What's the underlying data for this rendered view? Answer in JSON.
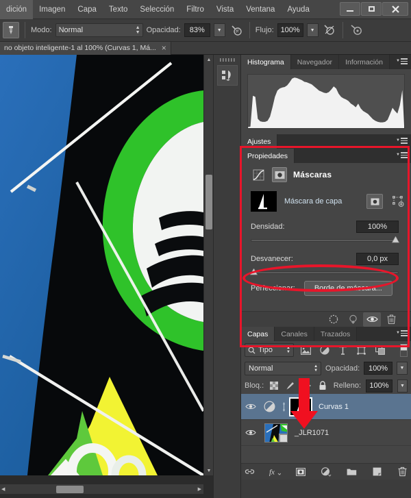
{
  "window": {
    "controls": [
      {
        "name": "minimize",
        "glyph": "—"
      },
      {
        "name": "maximize",
        "glyph": "❐"
      },
      {
        "name": "close",
        "glyph": "✕"
      }
    ]
  },
  "menubar": {
    "items": [
      "dición",
      "Imagen",
      "Capa",
      "Texto",
      "Selección",
      "Filtro",
      "Vista",
      "Ventana",
      "Ayuda"
    ]
  },
  "options_bar": {
    "tool_icon": "brush-tool-icon",
    "mode_label": "Modo:",
    "mode_value": "Normal",
    "opacity_label": "Opacidad:",
    "opacity_value": "83%",
    "airbrush_icon": "airbrush-icon",
    "flow_label": "Flujo:",
    "flow_value": "100%",
    "tablet_pressure_icon": "tablet-pressure-icon",
    "airbrush2_icon": "airbrush-alt-icon"
  },
  "document_tab": {
    "title": "no objeto inteligente-1 al 100% (Curvas 1, Má...",
    "close_glyph": "×"
  },
  "side_dock": {
    "button_name": "history-actions-icon"
  },
  "histogram_panel": {
    "tabs": [
      {
        "label": "Histograma",
        "active": true
      },
      {
        "label": "Navegador",
        "active": false
      },
      {
        "label": "Información",
        "active": false
      }
    ]
  },
  "adjustments_panel": {
    "tabs": [
      {
        "label": "Ajustes",
        "active": true
      }
    ]
  },
  "properties_panel": {
    "tabs": [
      {
        "label": "Propiedades",
        "active": true
      }
    ],
    "header": {
      "curves_icon": "curves-adjustment-icon",
      "pixel_mask_icon": "pixel-mask-icon",
      "title": "Máscaras"
    },
    "mask_row": {
      "thumb_name": "layer-mask-thumbnail",
      "label": "Máscara de capa",
      "pixel_mask_button": "pixel-mask-button",
      "vector_mask_button": "vector-mask-button"
    },
    "density": {
      "label": "Densidad:",
      "value": "100%",
      "knob_percent": 100
    },
    "feather": {
      "label": "Desvanecer:",
      "value": "0,0 px",
      "knob_percent": 0
    },
    "refine": {
      "label": "Perfeccionar:",
      "button_label": "Borde de máscara..."
    },
    "footer_buttons": [
      {
        "name": "load-selection-icon",
        "active": false
      },
      {
        "name": "apply-mask-icon",
        "active": false
      },
      {
        "name": "toggle-mask-visibility-icon",
        "active": true
      },
      {
        "name": "delete-mask-icon",
        "active": false
      }
    ]
  },
  "layers_panel": {
    "tabs": [
      {
        "label": "Capas",
        "active": true
      },
      {
        "label": "Canales",
        "active": false
      },
      {
        "label": "Trazados",
        "active": false
      }
    ],
    "filter": {
      "search_icon": "search-icon",
      "type_label": "Tipo",
      "icons": [
        {
          "name": "filter-pixel-layers-icon"
        },
        {
          "name": "filter-adjustment-layers-icon"
        },
        {
          "name": "filter-type-layers-icon"
        },
        {
          "name": "filter-shape-layers-icon"
        },
        {
          "name": "filter-smart-object-icon"
        }
      ],
      "toggle_name": "filter-enable-toggle"
    },
    "blend": {
      "mode_value": "Normal",
      "opacity_label": "Opacidad:",
      "opacity_value": "100%"
    },
    "lock": {
      "label": "Bloq.:",
      "icons": [
        {
          "name": "lock-transparency-icon"
        },
        {
          "name": "lock-image-icon"
        },
        {
          "name": "lock-position-icon"
        },
        {
          "name": "lock-all-icon"
        }
      ],
      "fill_label": "Relleno:",
      "fill_value": "100%"
    },
    "layers": [
      {
        "visible_icon": "eye-icon",
        "thumb_name": "curves-adjustment-thumbnail",
        "link_icon": "link-icon",
        "mask_thumb_name": "layer-mask-thumbnail",
        "name": "Curvas 1",
        "selected": true
      },
      {
        "visible_icon": "eye-icon",
        "thumb_name": "photo-layer-thumbnail",
        "name": "_JLR1071",
        "selected": false
      }
    ],
    "footer_buttons": [
      {
        "name": "link-layers-icon"
      },
      {
        "name": "layer-styles-fx-icon"
      },
      {
        "name": "add-layer-mask-icon"
      },
      {
        "name": "new-adjustment-layer-icon"
      },
      {
        "name": "new-group-icon"
      },
      {
        "name": "new-layer-icon"
      },
      {
        "name": "delete-layer-icon"
      }
    ]
  },
  "annotations": {
    "highlight_color": "#e8152a",
    "properties_outline": "red-rectangle-properties-panel",
    "feather_ellipse": "red-ellipse-feather-slider",
    "mask_arrow": "red-arrow-layer-mask-thumbnail"
  },
  "canvas": {
    "description": "sailing-photo",
    "scrollbars": {
      "vertical_name": "canvas-vertical-scrollbar",
      "horizontal_name": "canvas-horizontal-scrollbar"
    }
  },
  "chart_data": {
    "type": "area",
    "title": "Histograma",
    "xlabel": "",
    "ylabel": "",
    "x": [
      0,
      4,
      8,
      12,
      16,
      20,
      24,
      28,
      32,
      36,
      40,
      44,
      48,
      52,
      56,
      60,
      64,
      68,
      72,
      76,
      80,
      84,
      88,
      92,
      96,
      100,
      104,
      108,
      112,
      116,
      120,
      124,
      128,
      132,
      136,
      140,
      144,
      148,
      152,
      156,
      160,
      164,
      168,
      172,
      176,
      180,
      184,
      188,
      192,
      196,
      200,
      204,
      208,
      212,
      216,
      220,
      224,
      228,
      232,
      236,
      240,
      244,
      248,
      252,
      255
    ],
    "values": [
      2,
      3,
      62,
      60,
      18,
      13,
      12,
      12,
      14,
      22,
      40,
      60,
      72,
      76,
      78,
      79,
      82,
      88,
      95,
      97,
      96,
      94,
      92,
      89,
      88,
      86,
      84,
      80,
      76,
      72,
      70,
      68,
      67,
      69,
      74,
      80,
      76,
      66,
      60,
      57,
      55,
      52,
      47,
      44,
      40,
      47,
      38,
      33,
      30,
      27,
      22,
      17,
      14,
      12,
      11,
      11,
      12,
      16,
      27,
      39,
      33,
      28,
      44,
      73,
      5
    ],
    "ylim": [
      0,
      100
    ],
    "grid": false,
    "legend": "none"
  }
}
